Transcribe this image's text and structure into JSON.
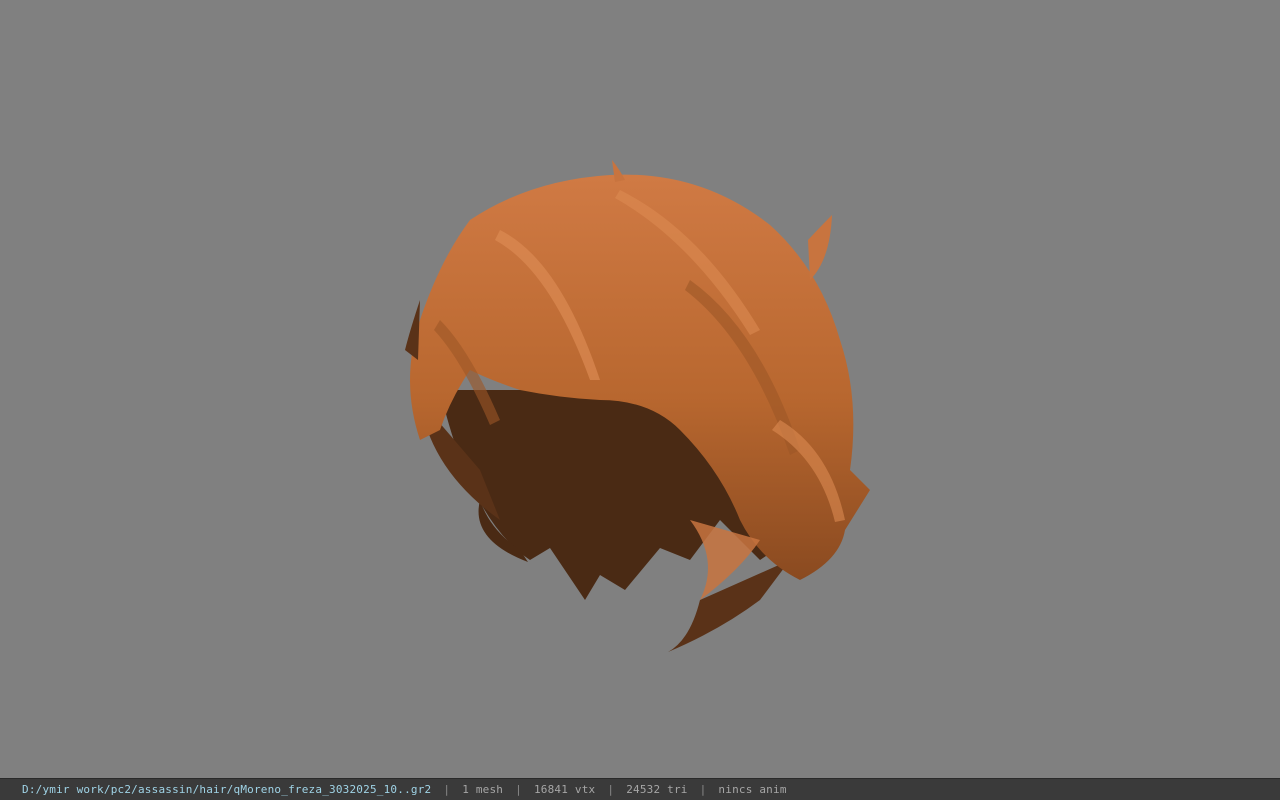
{
  "statusbar": {
    "file_path": "D:/ymir work/pc2/assassin/hair/qMoreno_freza_3032025_10..gr2",
    "mesh_count": "1 mesh",
    "vertex_count": "16841 vtx",
    "triangle_count": "24532 tri",
    "anim_status": "nincs anim",
    "separator": "|"
  },
  "viewport": {
    "background_color": "#808080",
    "model": "hair-mesh",
    "colors": {
      "hair_light": "#c8743f",
      "hair_mid": "#b0652f",
      "hair_dark": "#4a2a14"
    }
  }
}
